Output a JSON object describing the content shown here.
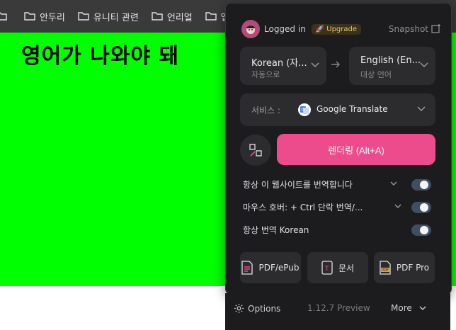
{
  "bookmarks": [
    {
      "label": ""
    },
    {
      "label": "안두리"
    },
    {
      "label": "유니티 관련"
    },
    {
      "label": "언리얼"
    },
    {
      "label": "앱"
    }
  ],
  "page": {
    "heading": "영어가 나와야 돼",
    "background_color": "#00ff00"
  },
  "popup": {
    "login_text": "Logged in",
    "upgrade_label": "Upgrade",
    "snapshot_label": "Snapshot",
    "source_lang": {
      "main": "Korean (자...",
      "sub": "자동으로"
    },
    "target_lang": {
      "main": "English (En...",
      "sub": "대상 언어"
    },
    "service": {
      "label": "서비스 :",
      "name": "Google Translate"
    },
    "render_button": "렌더링 (Alt+A)",
    "options": [
      {
        "label": "항상 이 웹사이트를 번역합니다",
        "has_dropdown": true,
        "toggle_on": false
      },
      {
        "label": "마우스 호버:  + Ctrl 단락 번역/...",
        "has_dropdown": true,
        "toggle_on": false
      },
      {
        "label": "항상 번역 Korean",
        "has_dropdown": false,
        "toggle_on": false
      }
    ],
    "tools": [
      {
        "label": "PDF/ePub",
        "icon": "pdf-epub-icon"
      },
      {
        "label": "문서",
        "icon": "document-icon"
      },
      {
        "label": "PDF Pro",
        "icon": "pdf-pro-icon"
      }
    ]
  },
  "footer": {
    "options_label": "Options",
    "version": "1.12.7 Preview",
    "more_label": "More"
  },
  "colors": {
    "accent": "#ec4c8b",
    "popup_bg": "#1c1c1e",
    "panel_bg": "#2c2c2e",
    "toggle_off": "#3f4e63"
  }
}
